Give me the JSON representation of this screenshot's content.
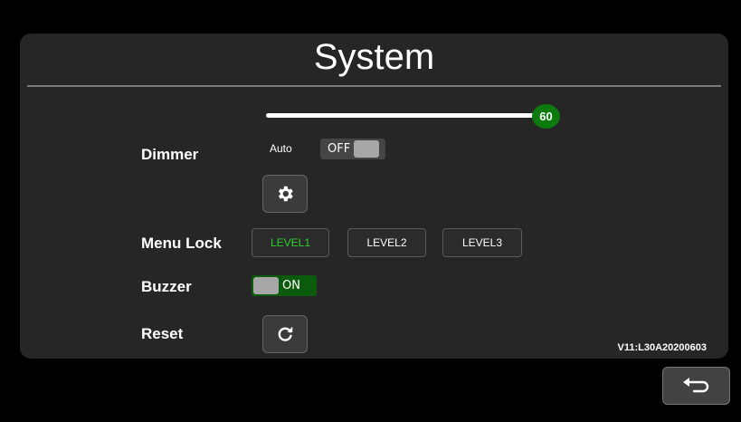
{
  "title": "System",
  "dimmer": {
    "label": "Dimmer",
    "slider_value": "60",
    "auto_label": "Auto",
    "auto_state": "OFF",
    "settings_icon": "gear-icon"
  },
  "menu_lock": {
    "label": "Menu Lock",
    "levels": [
      "LEVEL1",
      "LEVEL2",
      "LEVEL3"
    ],
    "selected": "LEVEL1"
  },
  "buzzer": {
    "label": "Buzzer",
    "state": "ON"
  },
  "reset": {
    "label": "Reset",
    "icon": "refresh-icon"
  },
  "version": "V11:L30A20200603",
  "back": {
    "icon": "back-arrow-icon"
  },
  "colors": {
    "background": "#000000",
    "panel": "#262626",
    "accent_green": "#0c7a0c",
    "active_text": "#2bd42b"
  }
}
